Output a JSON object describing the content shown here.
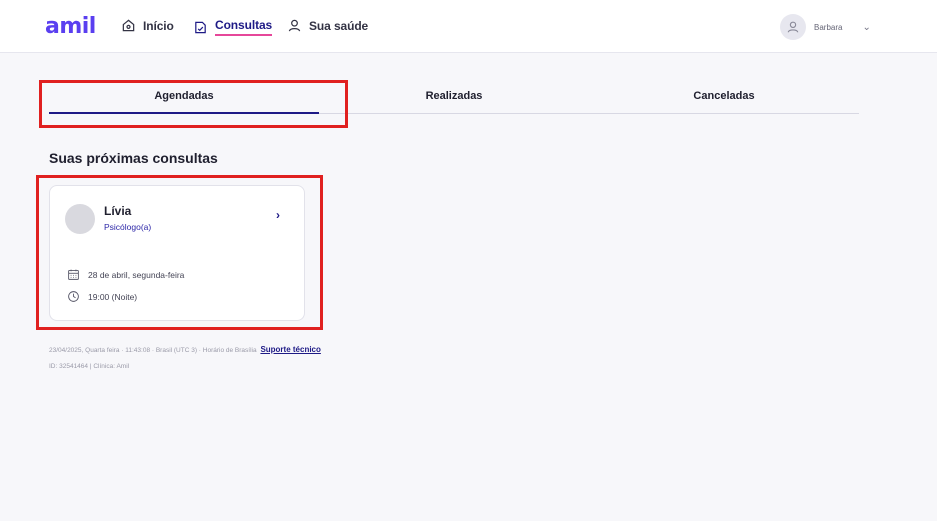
{
  "app": {
    "logo": "amil"
  },
  "nav": {
    "items": [
      {
        "label": "Início",
        "icon": "home-icon"
      },
      {
        "label": "Consultas",
        "icon": "calendar-doc-icon",
        "active": true
      },
      {
        "label": "Sua saúde",
        "icon": "person-icon"
      }
    ]
  },
  "user": {
    "name": "Barbara"
  },
  "tabs": [
    {
      "label": "Agendadas",
      "active": true
    },
    {
      "label": "Realizadas"
    },
    {
      "label": "Canceladas"
    }
  ],
  "section": {
    "title": "Suas próximas consultas"
  },
  "appointments": [
    {
      "professional": "Lívia",
      "specialty": "Psicólogo(a)",
      "date": "28 de abril, segunda-feira",
      "time": "19:00 (Noite)"
    }
  ],
  "footer": {
    "timestamp": "23/04/2025, Quarta feira · 11:43:08 · Brasil (UTC 3) · Horário de Brasília",
    "support_link": "Suporte técnico",
    "ids": "ID: 32541464 | Clínica: Amil"
  },
  "colors": {
    "brand": "#5a3ff0",
    "primary": "#1e1a86",
    "accent": "#e6479a",
    "highlight": "#e02020"
  }
}
